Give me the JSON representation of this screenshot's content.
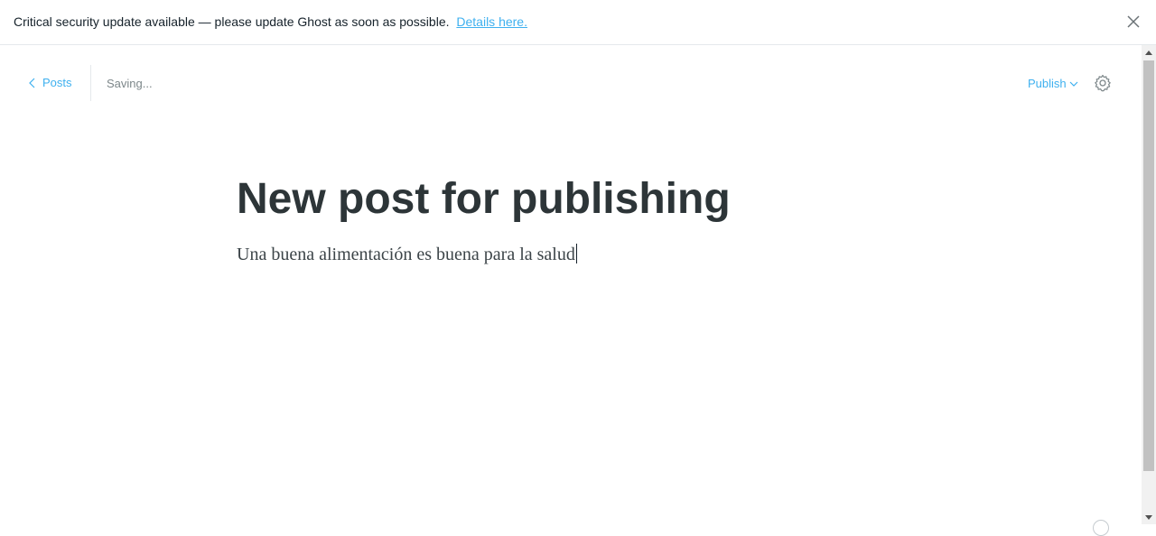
{
  "alert": {
    "message": "Critical security update available — please update Ghost as soon as possible.",
    "link_label": "Details here."
  },
  "header": {
    "back_label": "Posts",
    "status": "Saving...",
    "publish_label": "Publish"
  },
  "post": {
    "title": "New post for publishing",
    "body": "Una buena alimentación es buena para la salud"
  },
  "icons": {
    "close": "close-icon",
    "back": "chevron-left-icon",
    "publish_dropdown": "chevron-down-icon",
    "settings": "gear-icon",
    "help": "help-icon"
  },
  "colors": {
    "accent": "#3eb0ef",
    "title": "#2d3538",
    "text": "#15212a",
    "muted": "#7d878a"
  }
}
